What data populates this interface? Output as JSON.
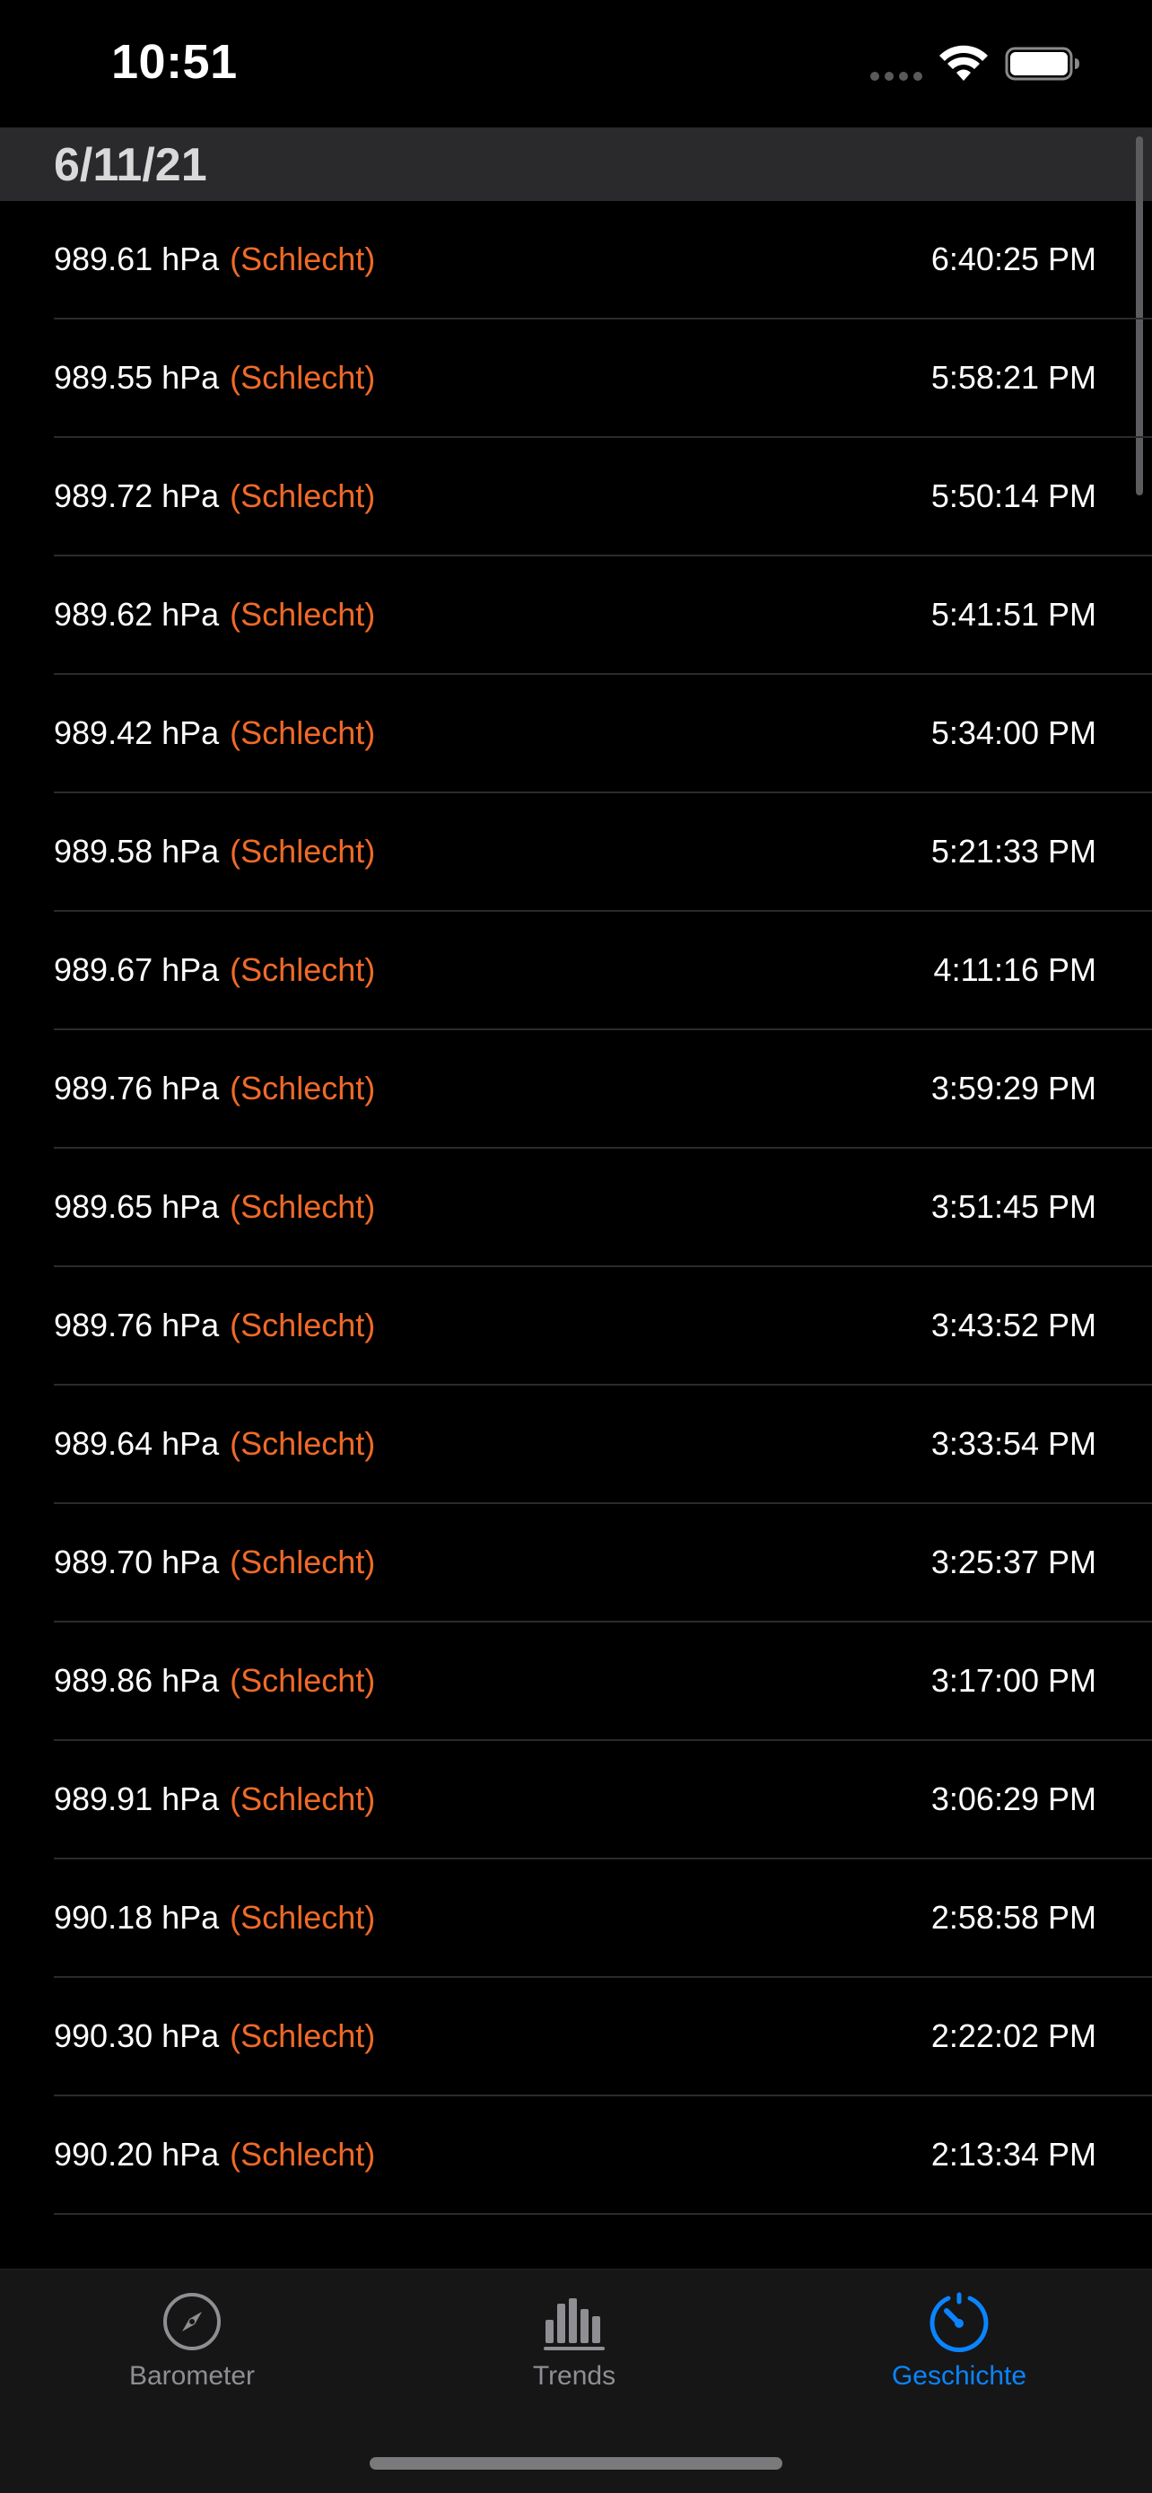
{
  "status_bar": {
    "time": "10:51"
  },
  "section": {
    "date": "6/11/21"
  },
  "readings": [
    {
      "pressure": "989.61 hPa",
      "condition": "(Schlecht)",
      "time": "6:40:25 PM"
    },
    {
      "pressure": "989.55 hPa",
      "condition": "(Schlecht)",
      "time": "5:58:21 PM"
    },
    {
      "pressure": "989.72 hPa",
      "condition": "(Schlecht)",
      "time": "5:50:14 PM"
    },
    {
      "pressure": "989.62 hPa",
      "condition": "(Schlecht)",
      "time": "5:41:51 PM"
    },
    {
      "pressure": "989.42 hPa",
      "condition": "(Schlecht)",
      "time": "5:34:00 PM"
    },
    {
      "pressure": "989.58 hPa",
      "condition": "(Schlecht)",
      "time": "5:21:33 PM"
    },
    {
      "pressure": "989.67 hPa",
      "condition": "(Schlecht)",
      "time": "4:11:16 PM"
    },
    {
      "pressure": "989.76 hPa",
      "condition": "(Schlecht)",
      "time": "3:59:29 PM"
    },
    {
      "pressure": "989.65 hPa",
      "condition": "(Schlecht)",
      "time": "3:51:45 PM"
    },
    {
      "pressure": "989.76 hPa",
      "condition": "(Schlecht)",
      "time": "3:43:52 PM"
    },
    {
      "pressure": "989.64 hPa",
      "condition": "(Schlecht)",
      "time": "3:33:54 PM"
    },
    {
      "pressure": "989.70 hPa",
      "condition": "(Schlecht)",
      "time": "3:25:37 PM"
    },
    {
      "pressure": "989.86 hPa",
      "condition": "(Schlecht)",
      "time": "3:17:00 PM"
    },
    {
      "pressure": "989.91 hPa",
      "condition": "(Schlecht)",
      "time": "3:06:29 PM"
    },
    {
      "pressure": "990.18 hPa",
      "condition": "(Schlecht)",
      "time": "2:58:58 PM"
    },
    {
      "pressure": "990.30 hPa",
      "condition": "(Schlecht)",
      "time": "2:22:02 PM"
    },
    {
      "pressure": "990.20 hPa",
      "condition": "(Schlecht)",
      "time": "2:13:34 PM"
    }
  ],
  "tabs": [
    {
      "label": "Barometer",
      "icon": "compass-icon",
      "active": false
    },
    {
      "label": "Trends",
      "icon": "bar-chart-icon",
      "active": false
    },
    {
      "label": "Geschichte",
      "icon": "history-gauge-icon",
      "active": true
    }
  ],
  "colors": {
    "background": "#000000",
    "section_header": "#2a2a2c",
    "condition_bad": "#f06a28",
    "tab_active": "#0a84ff",
    "tab_inactive": "#8e8e93"
  }
}
